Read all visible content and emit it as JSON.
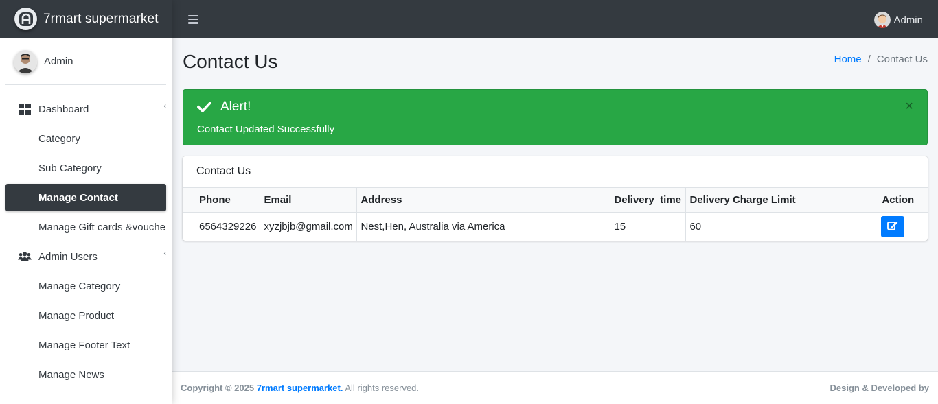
{
  "brand": {
    "name": "7rmart supermarket"
  },
  "sidebar": {
    "user_name": "Admin",
    "items": [
      {
        "label": "Dashboard",
        "icon": "th-large-icon",
        "has_caret": true
      },
      {
        "label": "Category"
      },
      {
        "label": "Sub Category"
      },
      {
        "label": "Manage Contact",
        "active": true
      },
      {
        "label": "Manage Gift cards &vouchers"
      },
      {
        "label": "Admin Users",
        "icon": "users-icon",
        "has_caret": true
      },
      {
        "label": "Manage Category"
      },
      {
        "label": "Manage Product"
      },
      {
        "label": "Manage Footer Text"
      },
      {
        "label": "Manage News"
      }
    ]
  },
  "topbar": {
    "user_label": "Admin"
  },
  "page": {
    "title": "Contact Us",
    "breadcrumb": {
      "home": "Home",
      "current": "Contact Us"
    }
  },
  "alert": {
    "heading": "Alert!",
    "message": "Contact Updated Successfully",
    "close": "×",
    "color": "#28a745"
  },
  "card": {
    "title": "Contact Us",
    "columns": [
      "Phone",
      "Email",
      "Address",
      "Delivery_time",
      "Delivery Charge Limit",
      "Action"
    ],
    "rows": [
      {
        "phone": "6564329226",
        "email": "xyzjbjb@gmail.com",
        "address": "Nest,Hen, Australia via America",
        "delivery_time": "15",
        "charge_limit": "60"
      }
    ]
  },
  "footer": {
    "copyright_prefix": "Copyright © 2025",
    "brand_link": "7rmart supermarket.",
    "rights": "All rights reserved.",
    "right_text": "Design & Developed by"
  },
  "colors": {
    "dark": "#343a40",
    "primary": "#007bff",
    "success": "#28a745"
  }
}
